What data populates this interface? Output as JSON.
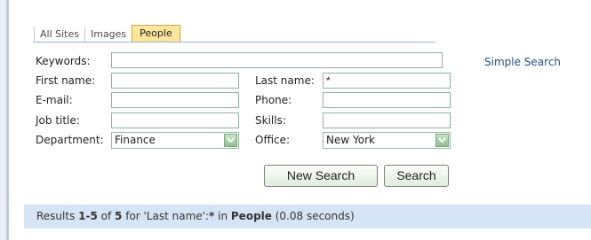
{
  "tabs": [
    {
      "label": "All Sites",
      "active": false
    },
    {
      "label": "Images",
      "active": false
    },
    {
      "label": "People",
      "active": true
    }
  ],
  "form": {
    "keywords_label": "Keywords:",
    "keywords_value": "",
    "first_name_label": "First name:",
    "first_name_value": "",
    "last_name_label": "Last name:",
    "last_name_value": "*",
    "email_label": "E-mail:",
    "email_value": "",
    "phone_label": "Phone:",
    "phone_value": "",
    "job_title_label": "Job title:",
    "job_title_value": "",
    "skills_label": "Skills:",
    "skills_value": "",
    "department_label": "Department:",
    "department_value": "Finance",
    "office_label": "Office:",
    "office_value": "New York"
  },
  "simple_search_link": "Simple Search",
  "buttons": {
    "new_search": "New Search",
    "search": "Search"
  },
  "results": {
    "prefix": "Results ",
    "range": "1-5",
    "of": " of ",
    "total": "5",
    "for_text": " for 'Last name':",
    "query": "*",
    "in_text": " in ",
    "scope": "People",
    "time": " (0.08 seconds)"
  },
  "colors": {
    "active_tab": "#fde59a",
    "results_bar": "#d6e5f5",
    "link": "#23508a"
  }
}
